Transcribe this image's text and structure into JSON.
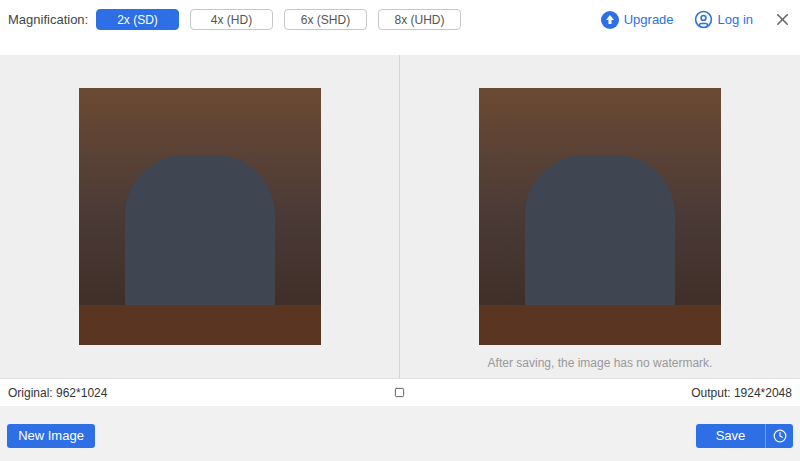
{
  "toolbar": {
    "label": "Magnification:",
    "options": [
      {
        "label": "2x (SD)",
        "selected": true
      },
      {
        "label": "4x (HD)",
        "selected": false
      },
      {
        "label": "6x (SHD)",
        "selected": false
      },
      {
        "label": "8x (UHD)",
        "selected": false
      }
    ],
    "upgrade": "Upgrade",
    "login": "Log in"
  },
  "preview": {
    "caption": "After saving, the image has no watermark."
  },
  "info": {
    "original": "Original: 962*1024",
    "output": "Output: 1924*2048"
  },
  "buttons": {
    "new_image": "New Image",
    "save": "Save"
  }
}
